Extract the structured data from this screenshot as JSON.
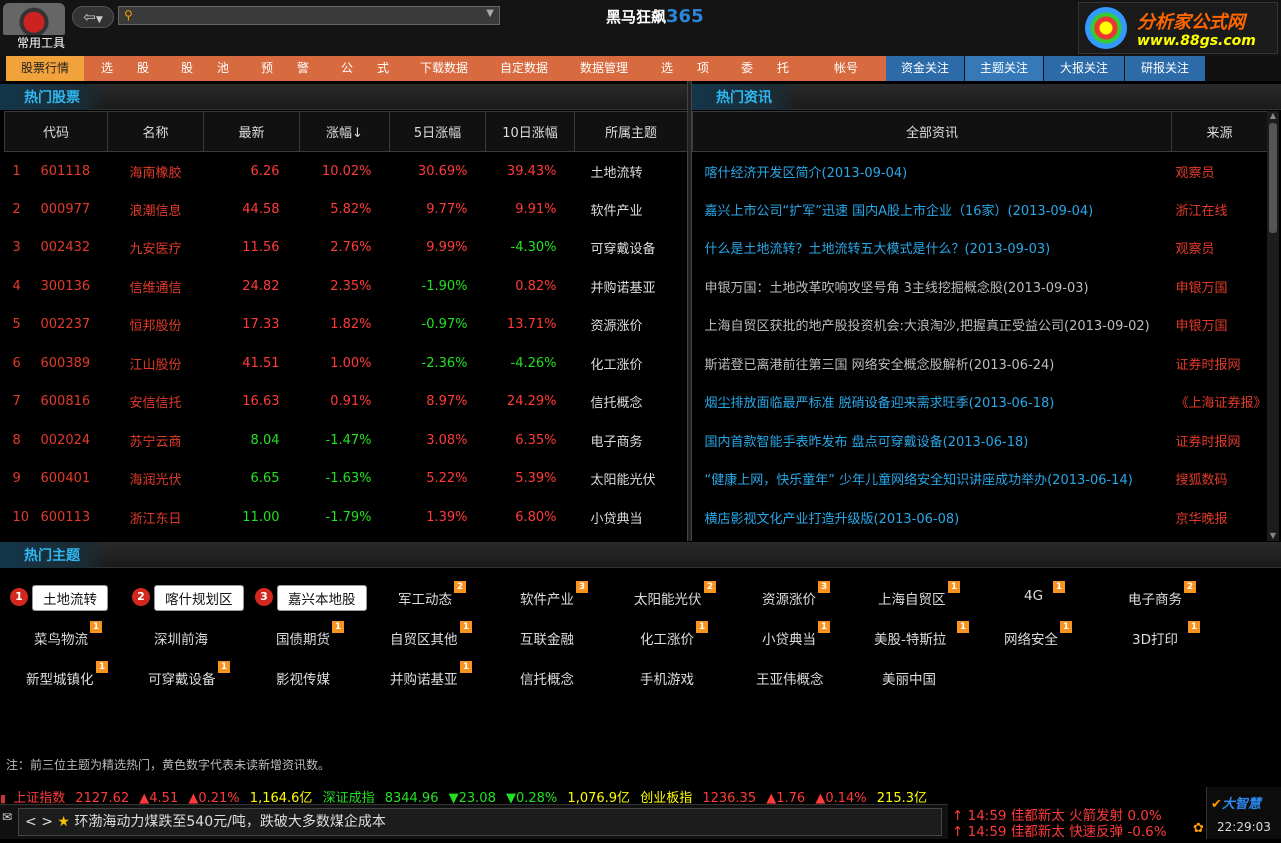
{
  "header": {
    "tools_label": "常用工具",
    "title_text": "黑马狂飙",
    "title_num": "365",
    "search_value": "",
    "brand_line1": "分析家公式网",
    "brand_line2": "www.88gs.com"
  },
  "menu": {
    "items": [
      "股票行情",
      "选",
      "股",
      "股",
      "池",
      "预",
      "警",
      "公",
      "式",
      "下载数据",
      "自定数据",
      "数据管理",
      "选",
      "项",
      "委",
      "托",
      "帐号",
      "资金关注",
      "主题关注",
      "大报关注",
      "研报关注"
    ]
  },
  "hot_stocks": {
    "title": "热门股票",
    "columns": [
      "代码",
      "名称",
      "最新",
      "涨幅↓",
      "5日涨幅",
      "10日涨幅",
      "所属主题"
    ],
    "rows": [
      {
        "idx": "1",
        "code": "601118",
        "name": "海南橡胶",
        "last": "6.26",
        "chg": "10.02%",
        "chg5": "30.69%",
        "chg10": "39.43%",
        "topic": "土地流转"
      },
      {
        "idx": "2",
        "code": "000977",
        "name": "浪潮信息",
        "last": "44.58",
        "chg": "5.82%",
        "chg5": "9.77%",
        "chg10": "9.91%",
        "topic": "软件产业"
      },
      {
        "idx": "3",
        "code": "002432",
        "name": "九安医疗",
        "last": "11.56",
        "chg": "2.76%",
        "chg5": "9.99%",
        "chg10": "-4.30%",
        "topic": "可穿戴设备"
      },
      {
        "idx": "4",
        "code": "300136",
        "name": "信维通信",
        "last": "24.82",
        "chg": "2.35%",
        "chg5": "-1.90%",
        "chg10": "0.82%",
        "topic": "并购诺基亚"
      },
      {
        "idx": "5",
        "code": "002237",
        "name": "恒邦股份",
        "last": "17.33",
        "chg": "1.82%",
        "chg5": "-0.97%",
        "chg10": "13.71%",
        "topic": "资源涨价"
      },
      {
        "idx": "6",
        "code": "600389",
        "name": "江山股份",
        "last": "41.51",
        "chg": "1.00%",
        "chg5": "-2.36%",
        "chg10": "-4.26%",
        "topic": "化工涨价"
      },
      {
        "idx": "7",
        "code": "600816",
        "name": "安信信托",
        "last": "16.63",
        "chg": "0.91%",
        "chg5": "8.97%",
        "chg10": "24.29%",
        "topic": "信托概念"
      },
      {
        "idx": "8",
        "code": "002024",
        "name": "苏宁云商",
        "last": "8.04",
        "chg": "-1.47%",
        "chg5": "3.08%",
        "chg10": "6.35%",
        "topic": "电子商务"
      },
      {
        "idx": "9",
        "code": "600401",
        "name": "海润光伏",
        "last": "6.65",
        "chg": "-1.63%",
        "chg5": "5.22%",
        "chg10": "5.39%",
        "topic": "太阳能光伏"
      },
      {
        "idx": "10",
        "code": "600113",
        "name": "浙江东日",
        "last": "11.00",
        "chg": "-1.79%",
        "chg5": "1.39%",
        "chg10": "6.80%",
        "topic": "小贷典当"
      }
    ]
  },
  "hot_news": {
    "title": "热门资讯",
    "columns": [
      "全部资讯",
      "来源"
    ],
    "rows": [
      {
        "text": "喀什经济开发区简介(2013-09-04)",
        "src": "观察员",
        "color": "cyan"
      },
      {
        "text": "嘉兴上市公司“扩军”迅速 国内A股上市企业（16家）(2013-09-04)",
        "src": "浙江在线",
        "color": "cyan"
      },
      {
        "text": "什么是土地流转？土地流转五大模式是什么？(2013-09-03)",
        "src": "观察员",
        "color": "cyan"
      },
      {
        "text": "申银万国：土地改革吹响攻坚号角 3主线挖掘概念股(2013-09-03)",
        "src": "申银万国",
        "color": "gray"
      },
      {
        "text": "上海自贸区获批的地产股投资机会:大浪淘沙,把握真正受益公司(2013-09-02)",
        "src": "申银万国",
        "color": "gray"
      },
      {
        "text": "斯诺登已离港前往第三国 网络安全概念股解析(2013-06-24)",
        "src": "证券时报网",
        "color": "gray"
      },
      {
        "text": "烟尘排放面临最严标准 脱硝设备迎来需求旺季(2013-06-18)",
        "src": "《上海证券报》",
        "color": "cyan"
      },
      {
        "text": "国内首款智能手表昨发布 盘点可穿戴设备(2013-06-18)",
        "src": "证券时报网",
        "color": "cyan"
      },
      {
        "text": "“健康上网，快乐童年” 少年儿童网络安全知识讲座成功举办(2013-06-14)",
        "src": "搜狐数码",
        "color": "cyan"
      },
      {
        "text": "横店影视文化产业打造升级版(2013-06-08)",
        "src": "京华晚报",
        "color": "cyan"
      }
    ]
  },
  "hot_topics": {
    "title": "热门主题",
    "featured": [
      {
        "rank": "1",
        "label": "土地流转"
      },
      {
        "rank": "2",
        "label": "喀什规划区"
      },
      {
        "rank": "3",
        "label": "嘉兴本地股"
      }
    ],
    "items": [
      {
        "label": "军工动态",
        "badge": "2"
      },
      {
        "label": "软件产业",
        "badge": "3"
      },
      {
        "label": "太阳能光伏",
        "badge": "2"
      },
      {
        "label": "资源涨价",
        "badge": "3"
      },
      {
        "label": "上海自贸区",
        "badge": "1"
      },
      {
        "label": "4G",
        "badge": "1"
      },
      {
        "label": "电子商务",
        "badge": "2"
      },
      {
        "label": "菜鸟物流",
        "badge": "1"
      },
      {
        "label": "深圳前海",
        "badge": ""
      },
      {
        "label": "国债期货",
        "badge": "1"
      },
      {
        "label": "自贸区其他",
        "badge": "1"
      },
      {
        "label": "互联金融",
        "badge": ""
      },
      {
        "label": "化工涨价",
        "badge": "1"
      },
      {
        "label": "小贷典当",
        "badge": "1"
      },
      {
        "label": "美股-特斯拉",
        "badge": "1"
      },
      {
        "label": "网络安全",
        "badge": "1"
      },
      {
        "label": "3D打印",
        "badge": "1"
      },
      {
        "label": "新型城镇化",
        "badge": "1"
      },
      {
        "label": "可穿戴设备",
        "badge": "1"
      },
      {
        "label": "影视传媒",
        "badge": ""
      },
      {
        "label": "并购诺基亚",
        "badge": "1"
      },
      {
        "label": "信托概念",
        "badge": ""
      },
      {
        "label": "手机游戏",
        "badge": ""
      },
      {
        "label": "王亚伟概念",
        "badge": ""
      },
      {
        "label": "美丽中国",
        "badge": ""
      }
    ],
    "note": "注：前三位主题为精选热门，黄色数字代表未读新增资讯数。"
  },
  "ticker": {
    "sh_name": "上证指数",
    "sh_val": "2127.62",
    "sh_chg": "▲4.51",
    "sh_pct": "▲0.21%",
    "sh_amt": "1,164.6亿",
    "sz_name": "深证成指",
    "sz_val": "8344.96",
    "sz_chg": "▼23.08",
    "sz_pct": "▼0.28%",
    "sz_amt": "1,076.9亿",
    "cy_name": "创业板指",
    "cy_val": "1236.35",
    "cy_chg": "▲1.76",
    "cy_pct": "▲0.14%",
    "cy_amt": "215.3亿"
  },
  "news_ticker": "环渤海动力煤跌至540元/吨，跌破大多数煤企成本",
  "alerts": [
    {
      "time": "14:59",
      "name": "佳都新太",
      "event": "火箭发射",
      "pct": "0.0%"
    },
    {
      "time": "14:59",
      "name": "佳都新太",
      "event": "快速反弹",
      "pct": "-0.6%"
    }
  ],
  "clock": {
    "brand": "大智慧",
    "time": "22:29:03"
  }
}
